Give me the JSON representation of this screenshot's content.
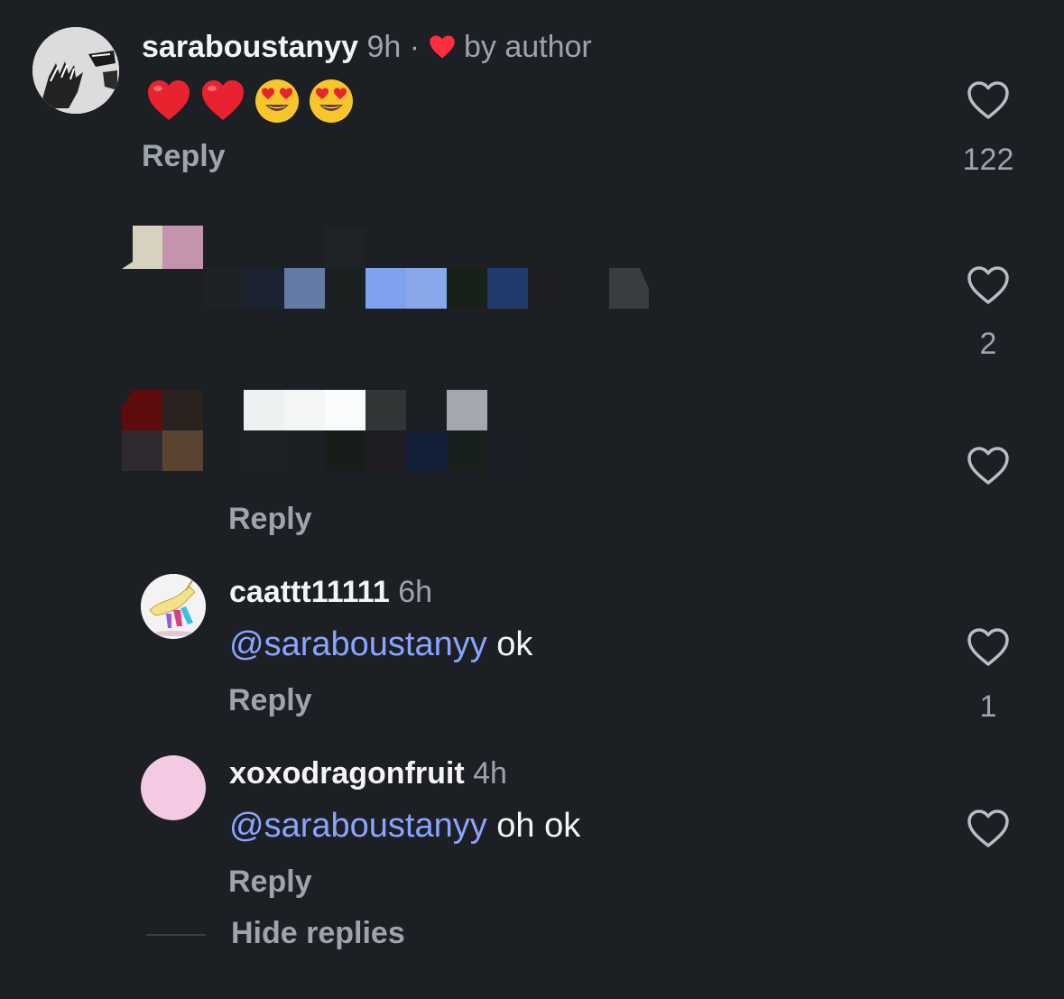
{
  "comments": [
    {
      "username": "saraboustanyy",
      "time": "9h",
      "separator": "·",
      "author_badge": "by author",
      "emojis": [
        "red-heart",
        "red-heart",
        "heart-eyes-face",
        "heart-eyes-face"
      ],
      "reply_label": "Reply",
      "like_count": "122"
    },
    {
      "like_count": "2"
    },
    {
      "reply_label": "Reply"
    }
  ],
  "replies": [
    {
      "username": "caattt11111",
      "time": "6h",
      "mention": "@saraboustanyy",
      "text": " ok",
      "reply_label": "Reply",
      "like_count": "1"
    },
    {
      "username": "xoxodragonfruit",
      "time": "4h",
      "mention": "@saraboustanyy",
      "text": " oh ok",
      "reply_label": "Reply"
    }
  ],
  "hide_replies_label": "Hide replies",
  "colors": {
    "background": "#1c1f23",
    "text_primary": "#f5f5f5",
    "text_secondary": "#9ea4ad",
    "mention": "#8aa4ff",
    "author_heart": "#ff2d3d"
  }
}
